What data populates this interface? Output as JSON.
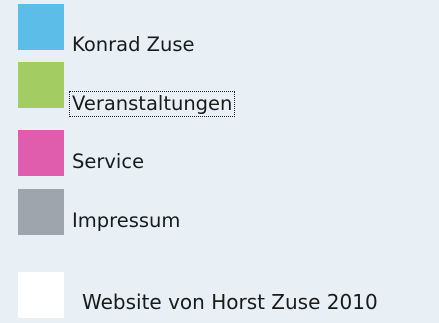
{
  "nav": {
    "items": [
      {
        "label": "Konrad Zuse",
        "color": "#5bbde8"
      },
      {
        "label": "Veranstaltungen",
        "color": "#a3cc63"
      },
      {
        "label": "Service",
        "color": "#e05dae"
      },
      {
        "label": "Impressum",
        "color": "#9ea5ad"
      }
    ]
  },
  "footer": {
    "text": "Website von Horst Zuse 2010",
    "color": "#ffffff"
  }
}
